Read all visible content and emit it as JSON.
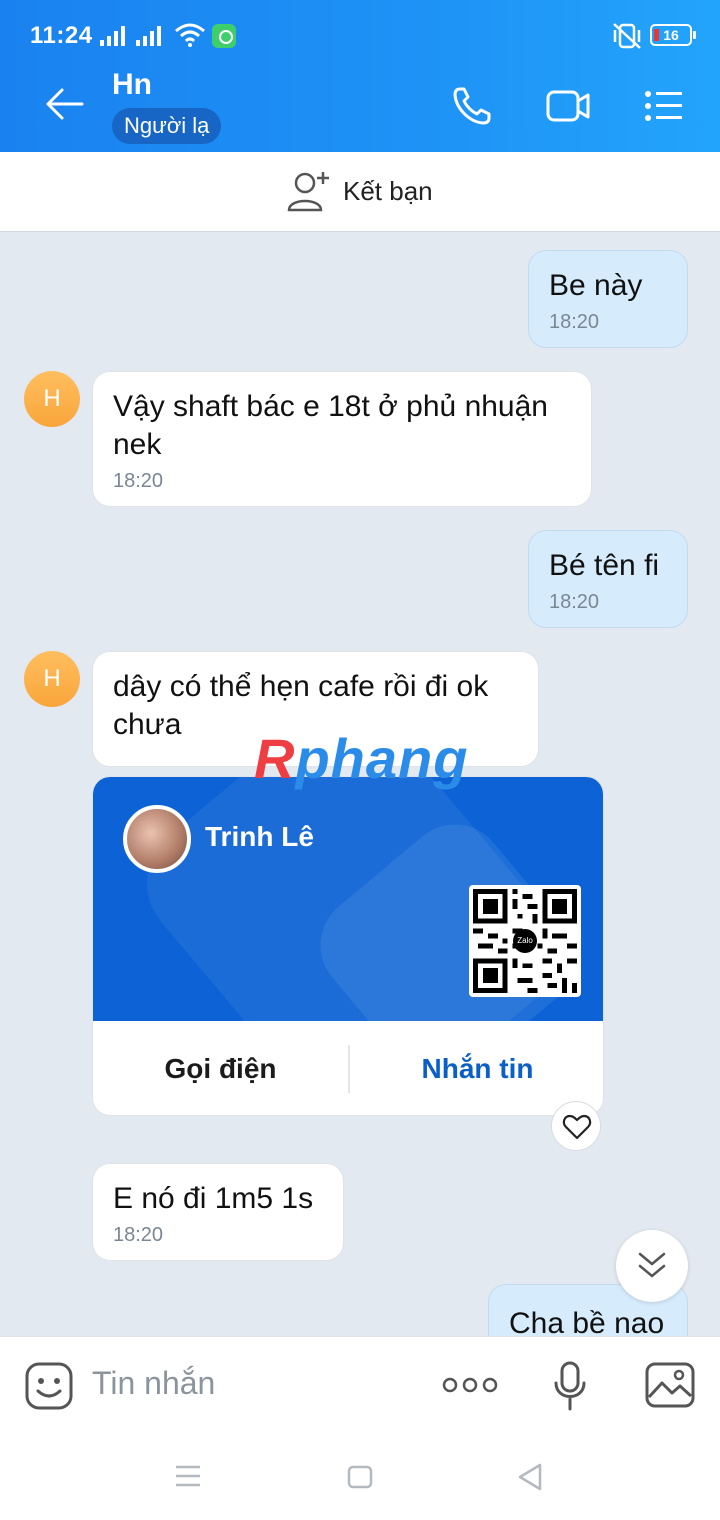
{
  "status_bar": {
    "time": "11:24",
    "battery": "16"
  },
  "header": {
    "title": "Hn",
    "badge": "Người lạ"
  },
  "add_friend": {
    "label": "Kết bạn"
  },
  "messages": [
    {
      "side": "out",
      "text": "Be này",
      "time": "18:20"
    },
    {
      "side": "in",
      "avatar": "H",
      "text": "Vậy shaft bác e 18t ở phủ nhuận nek",
      "time": "18:20"
    },
    {
      "side": "out",
      "text": "Bé tên fi",
      "time": "18:20"
    },
    {
      "side": "in",
      "avatar": "H",
      "text": "dây có thể hẹn cafe rồi đi ok chưa"
    },
    {
      "side": "in",
      "text": "E nó đi 1m5 1s",
      "time": "18:20"
    },
    {
      "side": "out",
      "text": "Cha bề nao"
    }
  ],
  "contact_card": {
    "name": "Trinh Lê",
    "qr_logo": "Zalo",
    "call_label": "Gọi điện",
    "message_label": "Nhắn tin"
  },
  "watermark": {
    "first": "R",
    "rest": "phang"
  },
  "input": {
    "placeholder": "Tin nhắn"
  },
  "colors": {
    "header": "#1e93f6",
    "outgoing_bubble": "#d6ecfc",
    "card": "#0d63d5",
    "avatar": "#f9a53a"
  }
}
